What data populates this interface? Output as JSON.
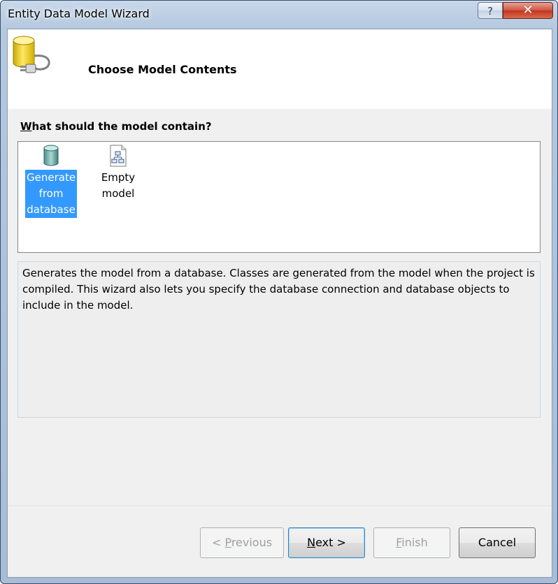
{
  "window": {
    "title": "Entity Data Model Wizard",
    "help_label": "?",
    "close_label": "✕"
  },
  "header": {
    "title": "Choose Model Contents",
    "icon": "database-plug-icon"
  },
  "question": {
    "mnemonic": "W",
    "rest": "hat should the model contain?"
  },
  "options": [
    {
      "label_lines": [
        "Generate",
        "from",
        "database"
      ],
      "icon": "database-icon",
      "selected": true
    },
    {
      "label_lines": [
        "Empty",
        "model"
      ],
      "icon": "empty-model-icon",
      "selected": false
    }
  ],
  "description": "Generates the model from a database. Classes are generated from the model when the project is compiled. This wizard also lets you specify the database connection and database objects to include in the model.",
  "buttons": {
    "previous": {
      "prefix": "< ",
      "mnemonic": "P",
      "rest": "revious",
      "enabled": false
    },
    "next": {
      "prefix": "",
      "mnemonic": "N",
      "rest": "ext >",
      "enabled": true
    },
    "finish": {
      "prefix": "",
      "mnemonic": "F",
      "rest": "inish",
      "enabled": false
    },
    "cancel": {
      "label": "Cancel",
      "enabled": true
    }
  },
  "colors": {
    "selection": "#3399ff",
    "title_bar": "#b4c8df",
    "close_button": "#c0341f"
  }
}
